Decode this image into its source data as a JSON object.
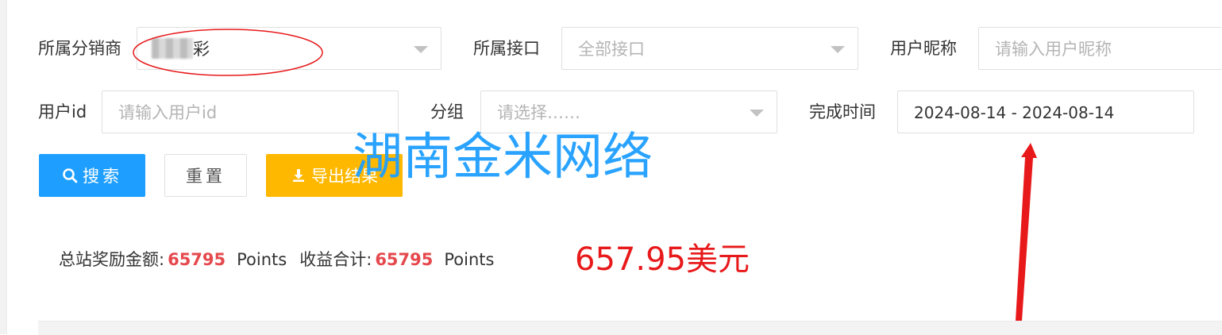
{
  "filters": {
    "distributor": {
      "label": "所属分销商",
      "value_suffix": "彩"
    },
    "interface": {
      "label": "所属接口",
      "placeholder": "全部接口"
    },
    "nickname": {
      "label": "用户昵称",
      "placeholder": "请输入用户昵称"
    },
    "user_id": {
      "label": "用户id",
      "placeholder": "请输入用户id"
    },
    "group": {
      "label": "分组",
      "placeholder": "请选择……"
    },
    "finish_time": {
      "label": "完成时间",
      "value": "2024-08-14 - 2024-08-14"
    }
  },
  "actions": {
    "search_label": "搜索",
    "reset_label": "重置",
    "export_label": "导出结果"
  },
  "summary": {
    "reward_label": "总站奖励金额:",
    "reward_amount": "65795",
    "reward_unit": "Points",
    "income_label": "收益合计:",
    "income_amount": "65795",
    "income_unit": "Points"
  },
  "annotations": {
    "watermark": "湖南金米网络",
    "usd_note": "657.95美元"
  },
  "colors": {
    "primary": "#1e9fff",
    "warning": "#ffb800",
    "amount": "#e5484d",
    "annotation_red": "#e8191b"
  }
}
